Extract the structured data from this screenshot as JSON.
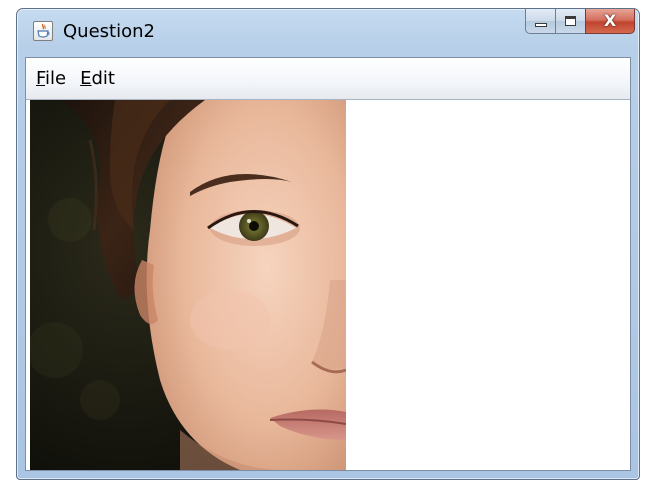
{
  "window": {
    "title": "Question2",
    "app_icon": "java-cup-icon",
    "caption_buttons": {
      "minimize_icon": "minimize-icon",
      "maximize_icon": "maximize-icon",
      "close_glyph": "X"
    }
  },
  "menubar": {
    "items": [
      {
        "mnemonic": "F",
        "rest": "ile"
      },
      {
        "mnemonic": "E",
        "rest": "dit"
      }
    ]
  },
  "content": {
    "image": "photo-half-face"
  },
  "colors": {
    "titlebar": "#b7cfe8",
    "close_button": "#c8503c",
    "client_background": "#ffffff"
  }
}
